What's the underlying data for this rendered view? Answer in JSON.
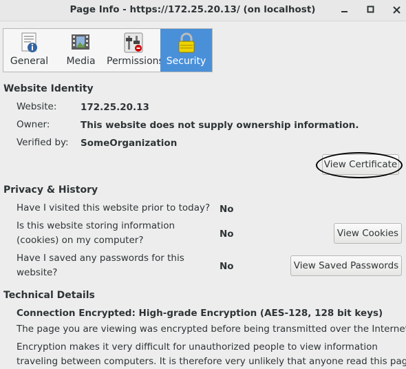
{
  "window": {
    "title": "Page Info - https://172.25.20.13/ (on localhost)",
    "controls": [
      "minimize",
      "maximize",
      "close"
    ]
  },
  "tabs": [
    {
      "label": "General",
      "icon": "document-info-icon",
      "active": false
    },
    {
      "label": "Media",
      "icon": "media-film-icon",
      "active": false
    },
    {
      "label": "Permissions",
      "icon": "permissions-switches-icon",
      "active": false
    },
    {
      "label": "Security",
      "icon": "padlock-icon",
      "active": true
    }
  ],
  "identity": {
    "heading": "Website Identity",
    "website_label": "Website:",
    "website_value": "172.25.20.13",
    "owner_label": "Owner:",
    "owner_value": "This website does not supply ownership information.",
    "verified_label": "Verified by:",
    "verified_value": "SomeOrganization",
    "view_certificate_button": "View Certificate"
  },
  "privacy": {
    "heading": "Privacy & History",
    "visited_question": "Have I visited this website prior to today?",
    "visited_answer": "No",
    "cookies_question_line1": "Is this website storing information",
    "cookies_question_line2": "(cookies) on my computer?",
    "cookies_answer": "No",
    "view_cookies_button": "View Cookies",
    "passwords_question_line1": "Have I saved any passwords for this",
    "passwords_question_line2": "website?",
    "passwords_answer": "No",
    "view_passwords_button": "View Saved Passwords"
  },
  "technical": {
    "heading": "Technical Details",
    "encryption_summary": "Connection Encrypted: High-grade Encryption (AES-128, 128 bit keys)",
    "para1": "The page you are viewing was encrypted before being transmitted over the Internet.",
    "para2_line1": "Encryption makes it very difficult for unauthorized people to view information",
    "para2_line2": "traveling between computers. It is therefore very unlikely that anyone read this page"
  },
  "colors": {
    "active_tab": "#4a90d9",
    "background": "#ededed",
    "text": "#2e3436"
  }
}
